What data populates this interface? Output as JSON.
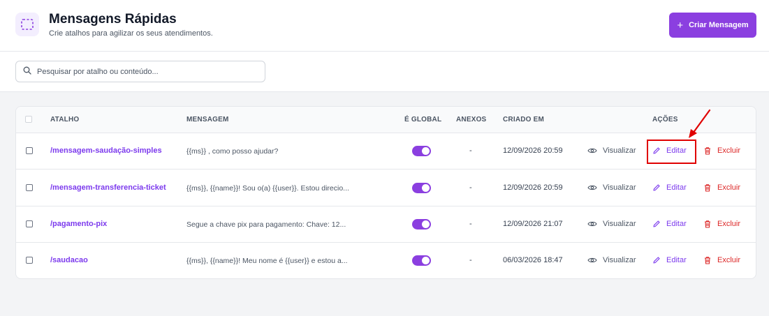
{
  "header": {
    "title": "Mensagens Rápidas",
    "subtitle": "Crie atalhos para agilizar os seus atendimentos.",
    "create_label": "Criar Mensagem",
    "create_icon": "plus-icon",
    "header_icon": "quick-messages-icon"
  },
  "search": {
    "placeholder": "Pesquisar por atalho ou conteúdo...",
    "icon": "search-icon"
  },
  "table": {
    "columns": [
      "ATALHO",
      "MENSAGEM",
      "É GLOBAL",
      "ANEXOS",
      "CRIADO EM",
      "AÇÕES"
    ],
    "rows": [
      {
        "shortcut": "/mensagem-saudação-simples",
        "message": "{{ms}} , como posso ajudar?",
        "global": true,
        "attachments": "-",
        "created": "12/09/2026 20:59"
      },
      {
        "shortcut": "/mensagem-transferencia-ticket",
        "message": "{{ms}}, {{name}}! Sou o(a) {{user}}. Estou direcio...",
        "global": true,
        "attachments": "-",
        "created": "12/09/2026 20:59"
      },
      {
        "shortcut": "/pagamento-pix",
        "message": "Segue a chave pix para pagamento: Chave: 12...",
        "global": true,
        "attachments": "-",
        "created": "12/09/2026 21:07"
      },
      {
        "shortcut": "/saudacao",
        "message": "{{ms}}, {{name}}! Meu nome é {{user}} e estou a...",
        "global": true,
        "attachments": "-",
        "created": "06/03/2026 18:47"
      }
    ],
    "actions": {
      "view": "Visualizar",
      "edit": "Editar",
      "delete": "Excluir"
    }
  },
  "colors": {
    "accent": "#8b3fe0",
    "link": "#7c3aed",
    "danger": "#dc2626",
    "annotation": "#e00000"
  }
}
